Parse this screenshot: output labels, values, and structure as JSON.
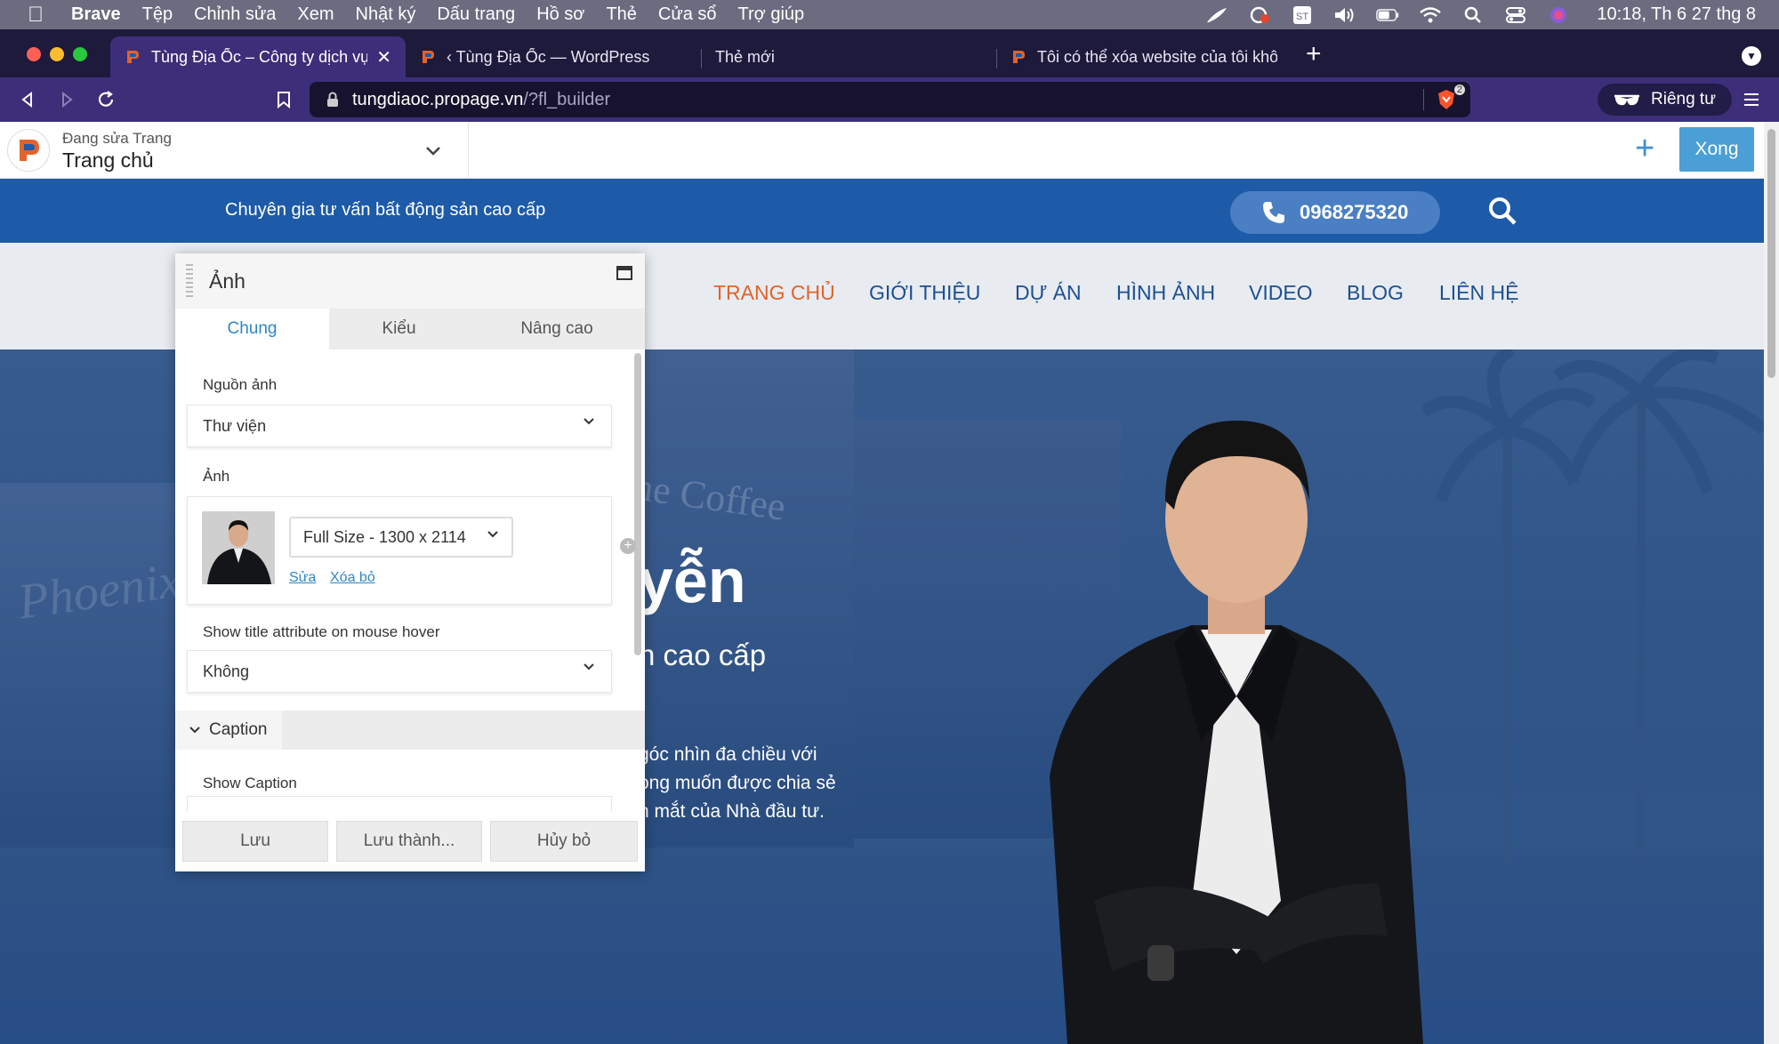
{
  "menubar": {
    "app": "Brave",
    "items": [
      "Tệp",
      "Chỉnh sửa",
      "Xem",
      "Nhật ký",
      "Dấu trang",
      "Hồ sơ",
      "Thẻ",
      "Cửa sổ",
      "Trợ giúp"
    ],
    "clock": "10:18, Th 6 27 thg 8",
    "tray_icons": [
      "feather-icon",
      "creative-cloud-icon",
      "st-icon",
      "volume-icon",
      "battery-icon",
      "wifi-icon",
      "spotlight-icon",
      "control-center-icon",
      "siri-icon"
    ]
  },
  "tabs": [
    {
      "title": "Tùng Địa Ốc – Công ty dịch vụ bất",
      "active": true
    },
    {
      "title": "‹ Tùng Địa Ốc — WordPress",
      "active": false
    },
    {
      "title": "Thẻ mới",
      "active": false
    },
    {
      "title": "Tôi có thể xóa website của tôi không",
      "active": false
    }
  ],
  "toolbar": {
    "url_host": "tungdiaoc.propage.vn",
    "url_path": "/?fl_builder",
    "shield_count": "2",
    "private_label": "Riêng tư"
  },
  "builder": {
    "editing_label": "Đang sửa Trang",
    "page_title": "Trang chủ",
    "done_label": "Xong"
  },
  "site": {
    "tagline": "Chuyên gia tư vấn bất động sản cao cấp",
    "phone": "0968275320",
    "nav": [
      "TRANG CHỦ",
      "GIỚI THIỆU",
      "DỰ ÁN",
      "HÌNH ẢNH",
      "VIDEO",
      "BLOG",
      "LIÊN HỆ"
    ],
    "hero_title_partial": "yễn",
    "hero_sub_partial": "n cao cấp",
    "hero_lines": [
      " góc nhìn đa chiều với",
      "ong muốn được chia sẻ",
      "n mắt của Nhà đầu tư."
    ],
    "signs": {
      "coffee": "ne Coffee",
      "phoenix": "Phoenix"
    }
  },
  "panel": {
    "title": "Ảnh",
    "tabs": [
      "Chung",
      "Kiểu",
      "Nâng cao"
    ],
    "source_label": "Nguồn ảnh",
    "source_value": "Thư viện",
    "image_label": "Ảnh",
    "size_value": "Full Size - 1300 x 2114",
    "edit_link": "Sửa",
    "remove_link": "Xóa bỏ",
    "title_attr_label": "Show title attribute on mouse hover",
    "title_attr_value": "Không",
    "caption_section": "Caption",
    "show_caption_label": "Show Caption",
    "buttons": {
      "save": "Lưu",
      "save_as": "Lưu thành...",
      "cancel": "Hủy bỏ"
    }
  },
  "colors": {
    "menubar": "#6b6c80",
    "tabstrip": "#1e1a3c",
    "toolbar": "#3d2e7a",
    "site_blue": "#1d5aa8",
    "nav_active": "#e3632a",
    "nav_text": "#1d4f93",
    "accent": "#4a9fd6"
  }
}
